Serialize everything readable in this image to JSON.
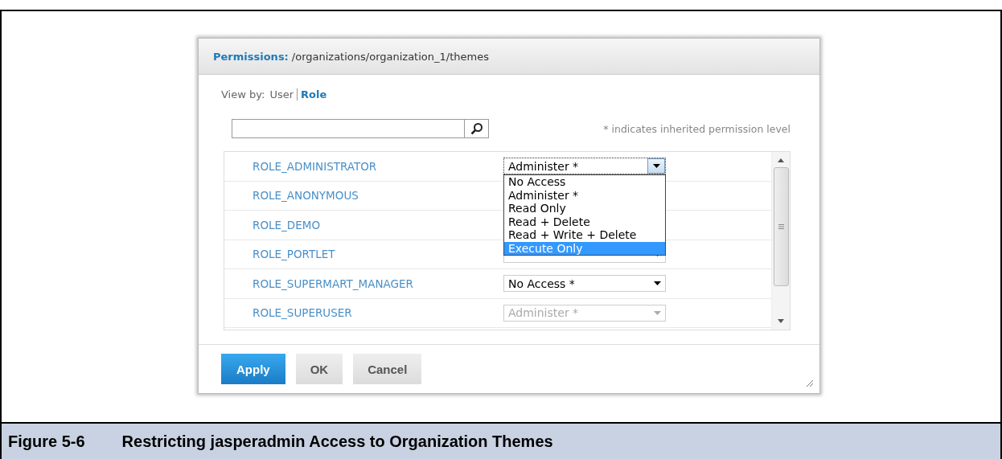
{
  "dialog": {
    "title_label": "Permissions:",
    "title_path": "/organizations/organization_1/themes",
    "view_by": {
      "label": "View by:",
      "options": [
        {
          "label": "User",
          "selected": false
        },
        {
          "label": "Role",
          "selected": true
        }
      ]
    },
    "note": "* indicates inherited permission level",
    "roles": [
      {
        "name": "ROLE_ADMINISTRATOR",
        "permission": "Administer *",
        "disabled": false,
        "options": [
          {
            "label": "No Access",
            "selected": false
          },
          {
            "label": "Administer *",
            "selected": false
          },
          {
            "label": "Read Only",
            "selected": false
          },
          {
            "label": "Read + Delete",
            "selected": false
          },
          {
            "label": "Read + Write + Delete",
            "selected": false
          },
          {
            "label": "Execute Only",
            "selected": true
          }
        ]
      },
      {
        "name": "ROLE_ANONYMOUS"
      },
      {
        "name": "ROLE_DEMO"
      },
      {
        "name": "ROLE_PORTLET",
        "disabled": false
      },
      {
        "name": "ROLE_SUPERMART_MANAGER",
        "permission": "No Access *",
        "disabled": false
      },
      {
        "name": "ROLE_SUPERUSER",
        "permission": "Administer *",
        "disabled": true
      }
    ],
    "buttons": [
      {
        "label": "Apply",
        "kind": "primary"
      },
      {
        "label": "OK",
        "kind": "secondary"
      },
      {
        "label": "Cancel",
        "kind": "secondary"
      }
    ]
  },
  "caption": {
    "number": "Figure 5-6",
    "text": "Restricting jasperadmin Access to Organization Themes"
  }
}
